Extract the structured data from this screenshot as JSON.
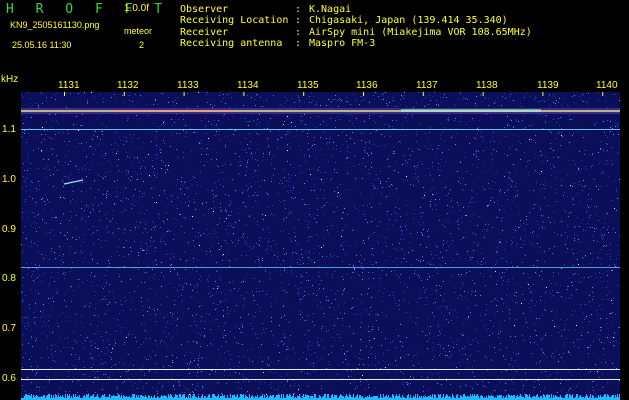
{
  "header": {
    "app_name": "H R O F F T",
    "version": "1.0.0f",
    "filename": "KN9_2505161130.png",
    "mode": "meteor",
    "timestamp": "25.05.16 11:30",
    "count": "2"
  },
  "info": [
    {
      "label": "Observer",
      "colon": ":",
      "value": "K.Nagai"
    },
    {
      "label": "Receiving Location",
      "colon": ":",
      "value": "Chigasaki, Japan (139.414 35.340)"
    },
    {
      "label": "Receiver",
      "colon": ":",
      "value": "AirSpy mini (Miakejima VOR 108.65MHz)"
    },
    {
      "label": "Receiving antenna",
      "colon": ":",
      "value": "Maspro FM-3"
    }
  ],
  "colors": {
    "header_green": "#34d43c",
    "text_yellow": "#ffff33",
    "background": "#0b0f5a",
    "trace": "#c8ffff"
  },
  "spectrogram": {
    "y_unit": "kHz",
    "y_ticks": [
      "1.1",
      "1.0",
      "0.9",
      "0.8",
      "0.7",
      "0.6"
    ],
    "x_ticks": [
      "1131",
      "1132",
      "1133",
      "1134",
      "1135",
      "1136",
      "1137",
      "1138",
      "1139",
      "1140"
    ]
  }
}
